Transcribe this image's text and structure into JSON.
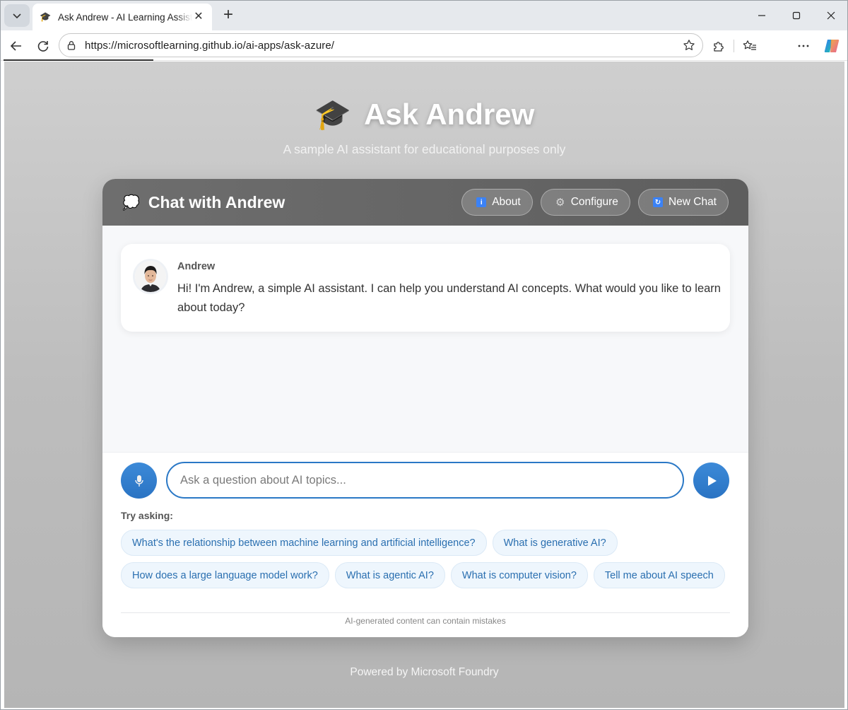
{
  "browser": {
    "tab_title": "Ask Andrew - AI Learning Assistant",
    "url": "https://microsoftlearning.github.io/ai-apps/ask-azure/",
    "tab_favicon": "graduation-cap-icon"
  },
  "hero": {
    "icon": "🎓",
    "title": "Ask Andrew",
    "subtitle": "A sample AI assistant for educational purposes only"
  },
  "chat": {
    "header": {
      "icon": "💭",
      "title": "Chat with Andrew",
      "buttons": {
        "about": "About",
        "configure": "Configure",
        "new_chat": "New Chat"
      }
    },
    "messages": [
      {
        "sender": "Andrew",
        "text": "Hi! I'm Andrew, a simple AI assistant. I can help you understand AI concepts. What would you like to learn about today?"
      }
    ],
    "input": {
      "value": "",
      "placeholder": "Ask a question about AI topics..."
    },
    "try_label": "Try asking:",
    "suggestions": [
      "What's the relationship between machine learning and artificial intelligence?",
      "What is generative AI?",
      "How does a large language model work?",
      "What is agentic AI?",
      "What is computer vision?",
      "Tell me about AI speech"
    ],
    "disclaimer": "AI-generated content can contain mistakes"
  },
  "footer": "Powered by Microsoft Foundry",
  "colors": {
    "accent": "#2a78c6",
    "header_bg": "#666666",
    "chip_bg": "#eef6fd",
    "chip_text": "#2a6fb0"
  }
}
